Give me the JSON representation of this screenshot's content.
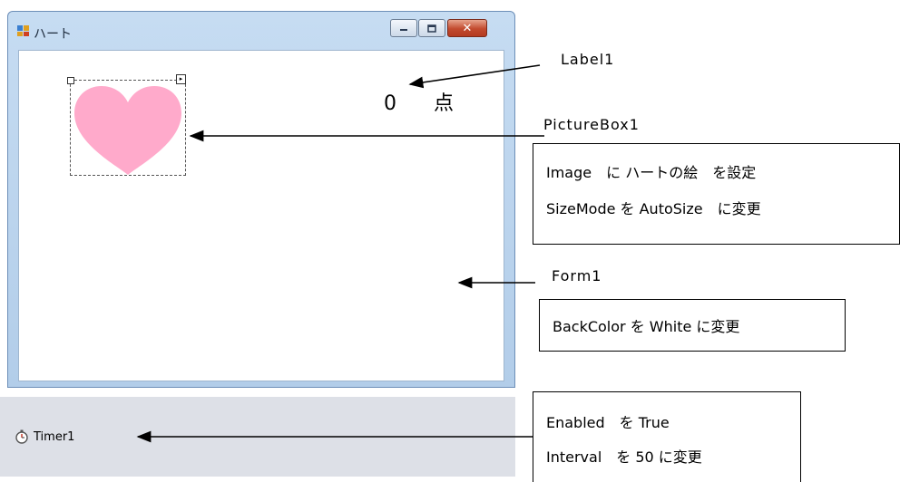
{
  "window": {
    "title": "ハート",
    "controls": {
      "minimize": "minimize",
      "maximize": "maximize",
      "close": "close"
    }
  },
  "form": {
    "back_color": "#ffffff",
    "label1": {
      "score": "0",
      "unit": "点"
    },
    "picturebox1": {
      "image": "heart-icon",
      "heart_color": "#ffaacb"
    }
  },
  "tray": {
    "timer_label": "Timer1"
  },
  "annotations": {
    "label1": {
      "name": "Label1"
    },
    "picturebox1": {
      "name": "PictureBox1",
      "line1": "Image　に ハートの絵　を設定",
      "line2": "SizeMode を AutoSize　に変更"
    },
    "form1": {
      "name": "Form1",
      "line1": "BackColor を White に変更"
    },
    "timer1": {
      "line1": "Enabled　を True",
      "line2": "Interval　を 50 に変更"
    }
  }
}
